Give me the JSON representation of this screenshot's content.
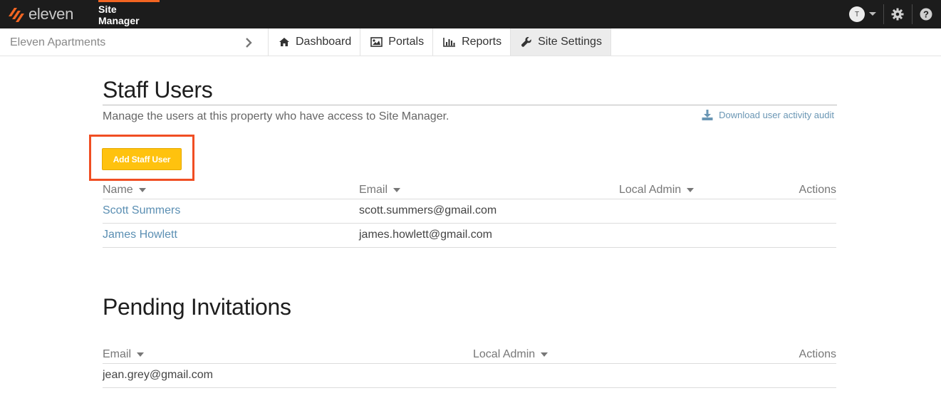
{
  "header": {
    "brand": "eleven",
    "app_title": "Site Manager",
    "user_initial": "T",
    "colors": {
      "bar": "#1c1c1c",
      "accent": "#f26522",
      "button": "#ffc20e",
      "link": "#5b8fb3"
    }
  },
  "subnav": {
    "property": "Eleven Apartments",
    "tabs": [
      {
        "label": "Dashboard",
        "icon": "home-icon"
      },
      {
        "label": "Portals",
        "icon": "image-icon"
      },
      {
        "label": "Reports",
        "icon": "bar-chart-icon"
      },
      {
        "label": "Site Settings",
        "icon": "wrench-icon",
        "active": true
      }
    ]
  },
  "staff": {
    "title": "Staff Users",
    "subtitle": "Manage the users at this property who have access to Site Manager.",
    "download_label": "Download user activity audit",
    "add_button": "Add Staff User",
    "columns": {
      "name": "Name",
      "email": "Email",
      "local_admin": "Local Admin",
      "actions": "Actions"
    },
    "rows": [
      {
        "name": "Scott Summers",
        "email": "scott.summers@gmail.com"
      },
      {
        "name": "James Howlett",
        "email": "james.howlett@gmail.com"
      }
    ]
  },
  "pending": {
    "title": "Pending Invitations",
    "columns": {
      "email": "Email",
      "local_admin": "Local Admin",
      "actions": "Actions"
    },
    "rows": [
      {
        "email": "jean.grey@gmail.com"
      }
    ]
  }
}
